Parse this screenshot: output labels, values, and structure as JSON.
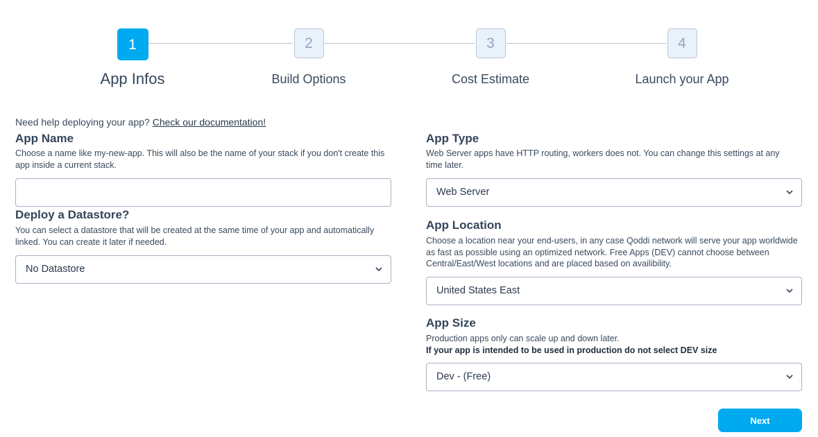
{
  "stepper": {
    "steps": [
      {
        "number": "1",
        "label": "App Infos"
      },
      {
        "number": "2",
        "label": "Build Options"
      },
      {
        "number": "3",
        "label": "Cost Estimate"
      },
      {
        "number": "4",
        "label": "Launch your App"
      }
    ],
    "active_step": 1
  },
  "help": {
    "text": "Need help deploying your app?",
    "link_label": "Check our documentation!"
  },
  "app_name": {
    "title": "App Name",
    "description": "Choose a name like my-new-app. This will also be the name of your stack if you don't create this app inside a current stack.",
    "value": "",
    "placeholder": ""
  },
  "datastore": {
    "title": "Deploy a Datastore?",
    "description": "You can select a datastore that will be created at the same time of your app and automatically linked. You can create it later if needed.",
    "selected": "No Datastore"
  },
  "app_type": {
    "title": "App Type",
    "description": "Web Server apps have HTTP routing, workers does not. You can change this settings at any time later.",
    "selected": "Web Server"
  },
  "app_location": {
    "title": "App Location",
    "description": "Choose a location near your end-users, in any case Qoddi network will serve your app worldwide as fast as possible using an optimized network. Free Apps (DEV) cannot choose between Central/East/West locations and are placed based on availibility.",
    "selected": "United States East"
  },
  "app_size": {
    "title": "App Size",
    "description": "Production apps only can scale up and down later.",
    "warning": "If your app is intended to be used in production do not select DEV size",
    "selected": "Dev - (Free)"
  },
  "actions": {
    "next_label": "Next"
  },
  "colors": {
    "accent": "#00aaf0",
    "inactive_step_bg": "#e9f1fb",
    "text": "#34455a"
  },
  "icons": {
    "select_caret": "chevron-down-icon"
  }
}
